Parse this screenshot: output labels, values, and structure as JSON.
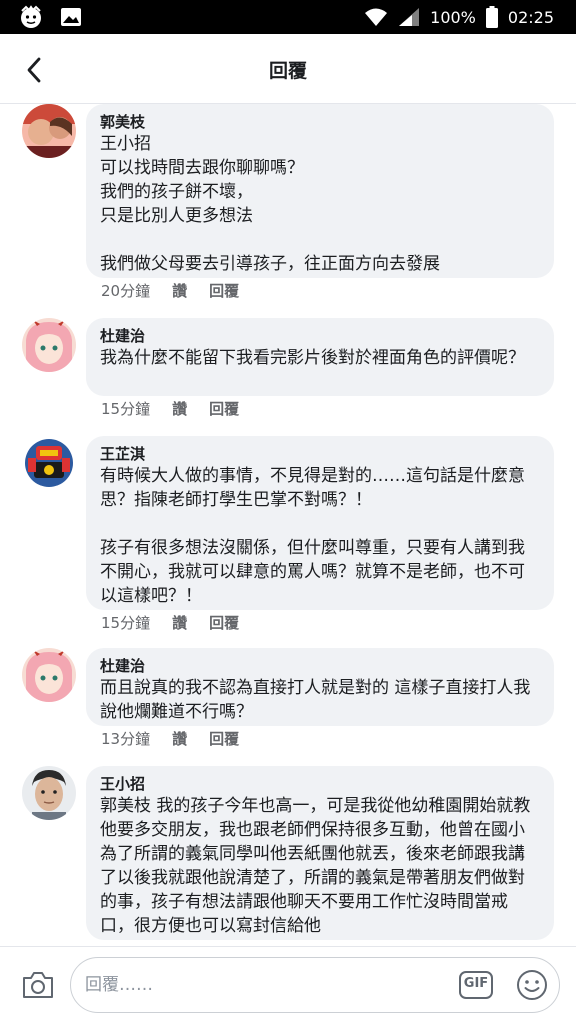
{
  "status_bar": {
    "battery": "100%",
    "time": "02:25",
    "icons": [
      "face-icon",
      "image-icon",
      "wifi-icon",
      "signal-icon",
      "battery-icon"
    ]
  },
  "header": {
    "title": "回覆",
    "back_icon": "chevron-left-icon"
  },
  "comments": [
    {
      "author": "郭美枝",
      "text": "王小招\n可以找時間去跟你聊聊嗎？\n我們的孩子餅不壞，\n只是比別人更多想法\n\n我們做父母要去引導孩子，往正面方向去發展",
      "time": "20分鐘",
      "like": "讚",
      "reply": "回覆"
    },
    {
      "author": "杜建治",
      "text": "我為什麼不能留下我看完影片後對於裡面角色的評價呢？",
      "time": "15分鐘",
      "like": "讚",
      "reply": "回覆"
    },
    {
      "author": "王芷淇",
      "text": "有時候大人做的事情，不見得是對的……這句話是什麼意思？指陳老師打學生巴掌不對嗎？！\n\n孩子有很多想法沒關係，但什麼叫尊重，只要有人講到我不開心，我就可以肆意的罵人嗎？就算不是老師，也不可以這樣吧？！",
      "time": "15分鐘",
      "like": "讚",
      "reply": "回覆"
    },
    {
      "author": "杜建治",
      "text": "而且說真的我不認為直接打人就是對的 這樣子直接打人我說他爛難道不行嗎？",
      "time": "13分鐘",
      "like": "讚",
      "reply": "回覆"
    },
    {
      "author": "王小招",
      "text": "郭美枝 我的孩子今年也高一，可是我從他幼稚園開始就教他要多交朋友，我也跟老師們保持很多互動，他曾在國小為了所謂的義氣同學叫他丟紙團他就丟，後來老師跟我講了以後我就跟他說清楚了，所謂的義氣是帶著朋友們做對的事，孩子有想法請跟他聊天不要用工作忙沒時間當戒口，很方便也可以寫封信給他",
      "time": "",
      "like": "",
      "reply": ""
    }
  ],
  "compose": {
    "placeholder": "回覆……",
    "camera_icon": "camera-icon",
    "gif_label": "GIF",
    "emoji_icon": "emoji-icon"
  }
}
